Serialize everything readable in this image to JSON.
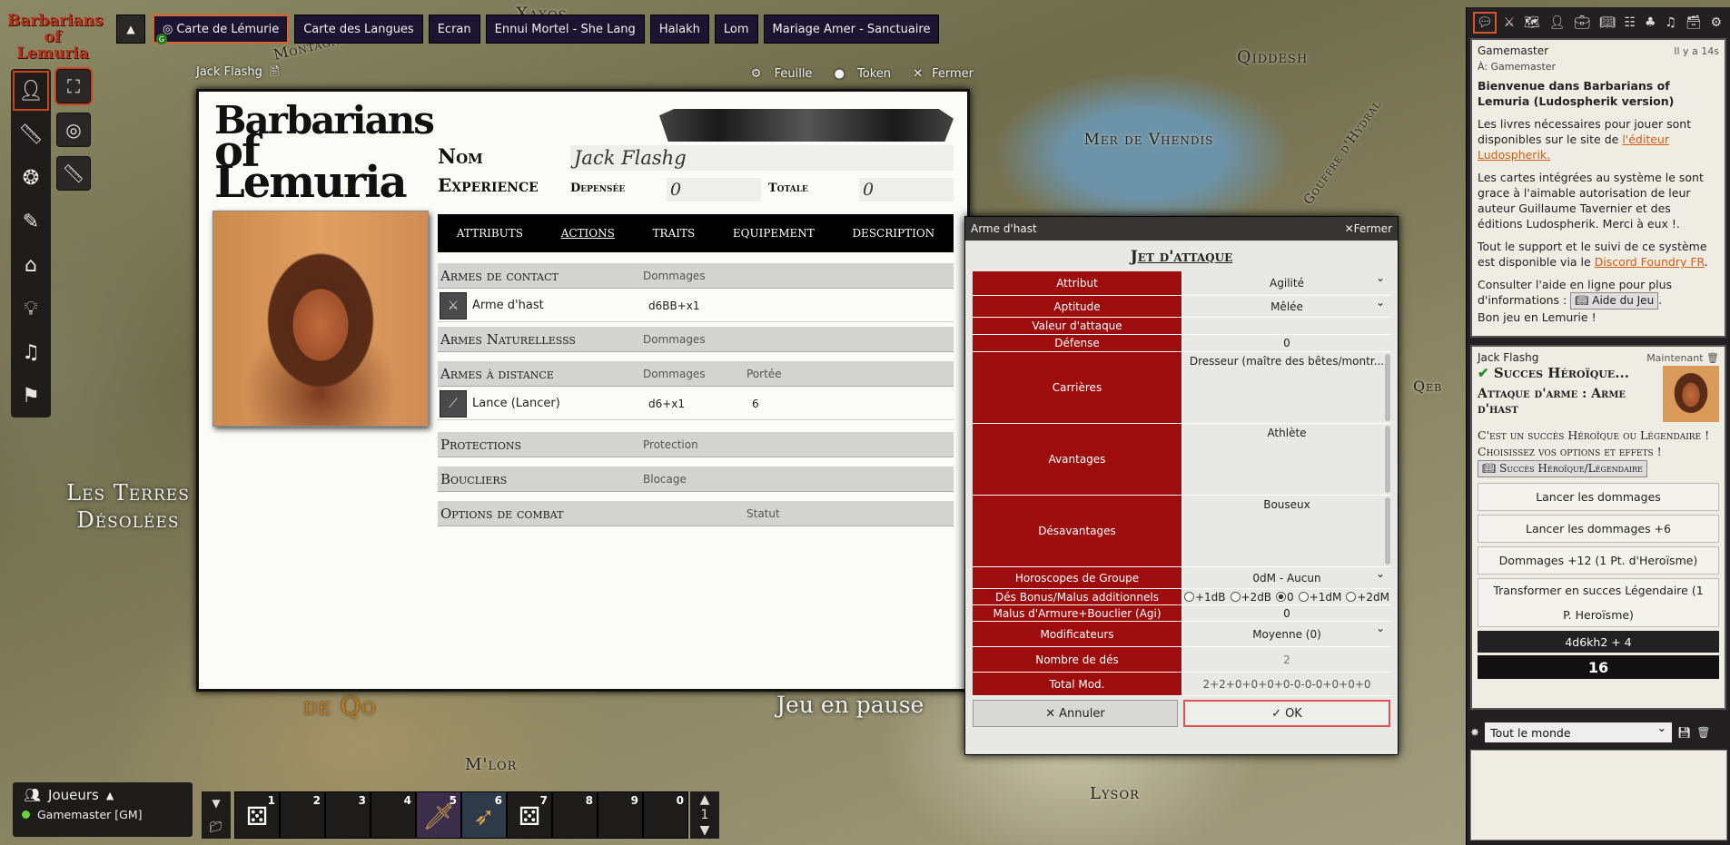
{
  "map": {
    "labels": [
      "Qiddesh",
      "Mer de Vhendis",
      "Gouffre d'Hydral",
      "Les Terres Désolées",
      "de Qo",
      "M'lor",
      "Lysor",
      "Qeb",
      "Montagnes",
      "Xaxos"
    ]
  },
  "logo": {
    "line1": "Barbarians",
    "line2": "of Lemuria"
  },
  "scenes": [
    {
      "label": "Carte de Lémurie",
      "active": true,
      "badge": "G"
    },
    {
      "label": "Carte des Langues"
    },
    {
      "label": "Ecran"
    },
    {
      "label": "Ennui Mortel - She Lang"
    },
    {
      "label": "Halakh"
    },
    {
      "label": "Lom"
    },
    {
      "label": "Mariage Amer - Sanctuaire"
    }
  ],
  "sheet": {
    "window_title": "Jack Flashg",
    "actions": {
      "sheet": "Feuille",
      "token": "Token",
      "close": "Fermer"
    },
    "logo": {
      "line1": "Barbarians",
      "line2": "of Lemuria"
    },
    "labels": {
      "name": "Nom",
      "experience": "Experience",
      "spent": "Depensée",
      "total": "Totale"
    },
    "values": {
      "name": "Jack Flashg",
      "spent": "0",
      "total": "0"
    },
    "tabs": [
      "Attributs",
      "Actions",
      "Traits",
      "Equipement",
      "Description"
    ],
    "active_tab": "Actions",
    "sections": {
      "melee": {
        "title": "Armes de contact",
        "col1": "Dommages"
      },
      "natural": {
        "title": "Armes Naturellesss",
        "col1": "Dommages"
      },
      "ranged": {
        "title": "Armes à distance",
        "col1": "Dommages",
        "col2": "Portée"
      },
      "protections": {
        "title": "Protections",
        "col1": "Protection"
      },
      "shields": {
        "title": "Boucliers",
        "col1": "Blocage"
      },
      "combat": {
        "title": "Options de combat",
        "col2": "Statut"
      }
    },
    "rows": {
      "melee_weapon": {
        "name": "Arme d'hast",
        "damage": "d6BB+x1"
      },
      "ranged_weapon": {
        "name": "Lance (Lancer)",
        "damage": "d6+x1",
        "range": "6"
      }
    }
  },
  "dialog": {
    "window_title": "Arme d'hast",
    "close": "Fermer",
    "title": "Jet d'attaque",
    "fields": {
      "attribut": {
        "label": "Attribut",
        "value": "Agilité"
      },
      "aptitude": {
        "label": "Aptitude",
        "value": "Mêlée"
      },
      "attack_value": {
        "label": "Valeur d'attaque",
        "value": ""
      },
      "defense": {
        "label": "Défense",
        "value": "0"
      },
      "careers": {
        "label": "Carrières",
        "value": "Dresseur (maître des bêtes/montr..."
      },
      "advantages": {
        "label": "Avantages",
        "value": "Athlète"
      },
      "disadvantages": {
        "label": "Désavantages",
        "value": "Bouseux"
      },
      "horoscope": {
        "label": "Horoscopes de Groupe",
        "value": "0dM - Aucun"
      },
      "bonus_dice": {
        "label": "Dés Bonus/Malus additionnels",
        "options": [
          "+1dB",
          "+2dB",
          "0",
          "+1dM",
          "+2dM"
        ],
        "selected": "0"
      },
      "armor_malus": {
        "label": "Malus d'Armure+Bouclier (Agi)",
        "value": "0"
      },
      "modifiers": {
        "label": "Modificateurs",
        "value": "Moyenne (0)"
      },
      "dice_count": {
        "label": "Nombre de dés",
        "value": "2"
      },
      "total_mod": {
        "label": "Total Mod.",
        "value": "2+2+0+0+0+0-0-0-0+0+0+0"
      }
    },
    "buttons": {
      "cancel": "Annuler",
      "ok": "OK"
    }
  },
  "sidebar": {
    "tabs": [
      "chat-icon",
      "combat-icon",
      "scenes-icon",
      "actors-icon",
      "items-icon",
      "journal-icon",
      "tables-icon",
      "cards-icon",
      "playlists-icon",
      "compendium-icon",
      "settings-icon"
    ],
    "message1": {
      "author": "Gamemaster",
      "time": "Il y a 14s",
      "whisper": "À: Gamemaster",
      "title": "Bienvenue dans Barbarians of Lemuria (Ludospherik version)",
      "p1_text": "Les livres nécessaires pour jouer sont disponibles sur le site de ",
      "p1_link": "l'éditeur Ludospherik.",
      "p2": "Les cartes intégrées au système le sont grace à l'aimable autorisation de leur auteur Guillaume Tavernier et des éditions Ludospherik. Merci à eux !.",
      "p3_text": "Tout le support et le suivi de ce système est disponible via le ",
      "p3_link": "Discord Foundry FR",
      "p4_text": "Consulter l'aide en ligne pour plus d'informations : ",
      "p4_chip": "Aide du Jeu",
      "p4_end": "Bon jeu en Lemurie !"
    },
    "message2": {
      "author": "Jack Flashg",
      "time": "Maintenant",
      "result": "Succes Héroïque...",
      "title": "Attaque d'arme : Arme d'hast",
      "body": "C'est un succès Héroïque ou Légendaire ! Choisissez vos options et effets !",
      "chip": "Succès Héroïque/Légendaire",
      "buttons": [
        "Lancer les dommages",
        "Lancer les dommages +6",
        "Dommages +12 (1 Pt. d'Heroïsme)",
        "Transformer en succes Légendaire (1 P. Heroïsme)"
      ],
      "formula": "4d6kh2 + 4",
      "total": "16"
    },
    "roll_mode": "Tout le monde"
  },
  "players": {
    "header": "Joueurs",
    "list": [
      "Gamemaster [GM]"
    ]
  },
  "hotbar": {
    "slots": [
      "1",
      "2",
      "3",
      "4",
      "5",
      "6",
      "7",
      "8",
      "9",
      "0"
    ],
    "page": "1"
  },
  "paused": "Jeu en pause",
  "colors": {
    "accent": "#e0622b",
    "dialog_label_bg": "#9e0d0d",
    "scene_bg": "#1c1430"
  }
}
